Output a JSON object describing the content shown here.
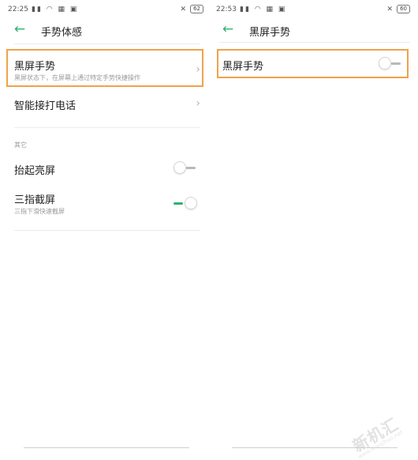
{
  "left_screen": {
    "status": {
      "time": "22:25",
      "battery": "62"
    },
    "title": "手势体感",
    "items": [
      {
        "label": "黑屏手势",
        "subtitle": "黑屏状态下，在屏幕上通过特定手势快捷操作"
      },
      {
        "label": "智能接打电话"
      }
    ],
    "section_header": "其它",
    "toggles": [
      {
        "label": "抬起亮屏",
        "state": "off"
      },
      {
        "label": "三指截屏",
        "subtitle": "三指下滑快速截屏",
        "state": "on"
      }
    ]
  },
  "right_screen": {
    "status": {
      "time": "22:53",
      "battery": "60"
    },
    "title": "黑屏手势",
    "toggle": {
      "label": "黑屏手势",
      "state": "off"
    }
  },
  "watermark": {
    "text": "新机汇",
    "url": "www.xianjihuo.net"
  },
  "colors": {
    "accent": "#2db36b",
    "highlight": "#f0a24a",
    "divider": "#ececec"
  }
}
